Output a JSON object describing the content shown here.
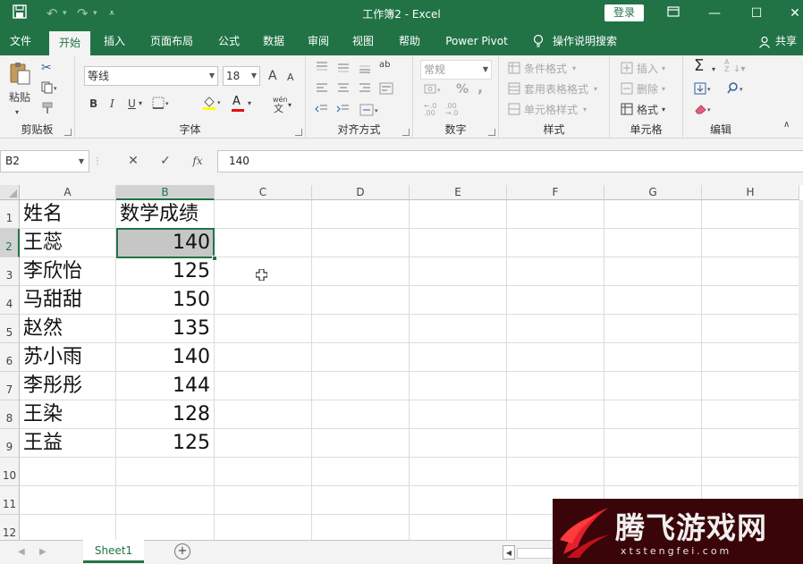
{
  "window": {
    "title": "工作簿2 - Excel",
    "login_label": "登录"
  },
  "titlebar_icons": {
    "save": "save-icon",
    "undo": "undo-icon",
    "redo": "redo-icon",
    "customize": "customize-qat-icon"
  },
  "tabs": [
    "文件",
    "开始",
    "插入",
    "页面布局",
    "公式",
    "数据",
    "审阅",
    "视图",
    "帮助",
    "Power Pivot"
  ],
  "active_tab": "开始",
  "tell_me": "操作说明搜索",
  "share": "共享",
  "ribbon": {
    "clipboard": {
      "label": "剪贴板",
      "paste": "粘贴"
    },
    "font": {
      "label": "字体",
      "name": "等线",
      "size": "18",
      "grow": "A",
      "shrink": "A",
      "bold": "B",
      "italic": "I",
      "underline": "U",
      "color_a": "A",
      "wen": "wén"
    },
    "alignment": {
      "label": "对齐方式",
      "orient": "ab"
    },
    "number": {
      "label": "数字",
      "format": "常规",
      "percent": "%",
      "comma": ",",
      "inc": "+.0\n.00",
      "dec": ".00\n→.0"
    },
    "styles": {
      "label": "样式",
      "conditional": "条件格式",
      "table": "套用表格格式",
      "cell": "单元格样式"
    },
    "cells": {
      "label": "单元格",
      "insert": "插入",
      "delete": "删除",
      "format": "格式"
    },
    "editing": {
      "label": "编辑",
      "sum": "Σ",
      "sort": "A Z"
    }
  },
  "formula_bar": {
    "name_box": "B2",
    "cancel": "✕",
    "enter": "✓",
    "fx": "fx",
    "value": "140"
  },
  "columns": [
    "A",
    "B",
    "C",
    "D",
    "E",
    "F",
    "G",
    "H"
  ],
  "rows": [
    "1",
    "2",
    "3",
    "4",
    "5",
    "6",
    "7",
    "8",
    "9",
    "10",
    "11",
    "12"
  ],
  "cells": [
    [
      "姓名",
      "数学成绩"
    ],
    [
      "王蕊",
      "140"
    ],
    [
      "李欣怡",
      "125"
    ],
    [
      "马甜甜",
      "150"
    ],
    [
      "赵然",
      "135"
    ],
    [
      "苏小雨",
      "140"
    ],
    [
      "李彤彤",
      "144"
    ],
    [
      "王染",
      "128"
    ],
    [
      "王益",
      "125"
    ]
  ],
  "selected_cell": "B2",
  "sheet_tabs": [
    "Sheet1"
  ],
  "add_sheet": "+",
  "watermark": {
    "text": "腾飞游戏网",
    "sub": "xtstengfei.com"
  },
  "colors": {
    "accent": "#217346",
    "selected_fill": "#c6c6c6"
  }
}
